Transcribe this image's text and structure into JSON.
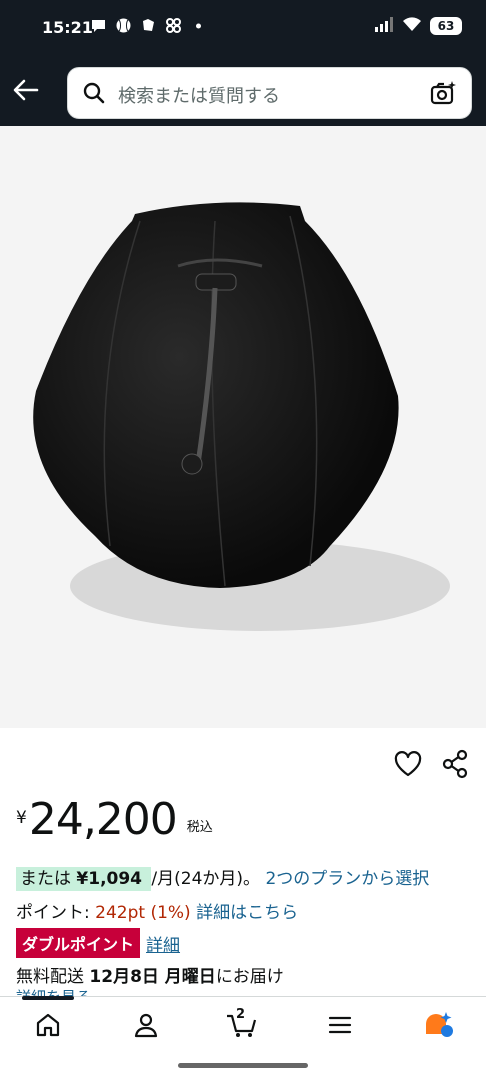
{
  "status_bar": {
    "time": "15:21",
    "battery": "63"
  },
  "search": {
    "placeholder": "検索または質問する"
  },
  "product": {
    "price": {
      "currency": "¥",
      "amount": "24,200",
      "tax_label": "税込"
    },
    "installment": {
      "prefix": "または",
      "amount": "¥1,094",
      "term": "/月(24か月)。",
      "link": "2つのプランから選択"
    },
    "points": {
      "label": "ポイント:",
      "value": "242pt",
      "percent": "(1%)",
      "link": "詳細はこちら"
    },
    "double_point": {
      "badge": "ダブルポイント",
      "link": "詳細"
    },
    "delivery": {
      "prefix": "無料配送",
      "date": "12月8日 月曜日",
      "suffix": "にお届け"
    },
    "more_link": "詳細を見る"
  },
  "bottom_nav": {
    "cart_count": "2"
  },
  "colors": {
    "header_bg": "#131a22",
    "link": "#1a6390",
    "price_red": "#b12704",
    "badge_red": "#c7003a",
    "install_bg": "#c8f0dc"
  }
}
